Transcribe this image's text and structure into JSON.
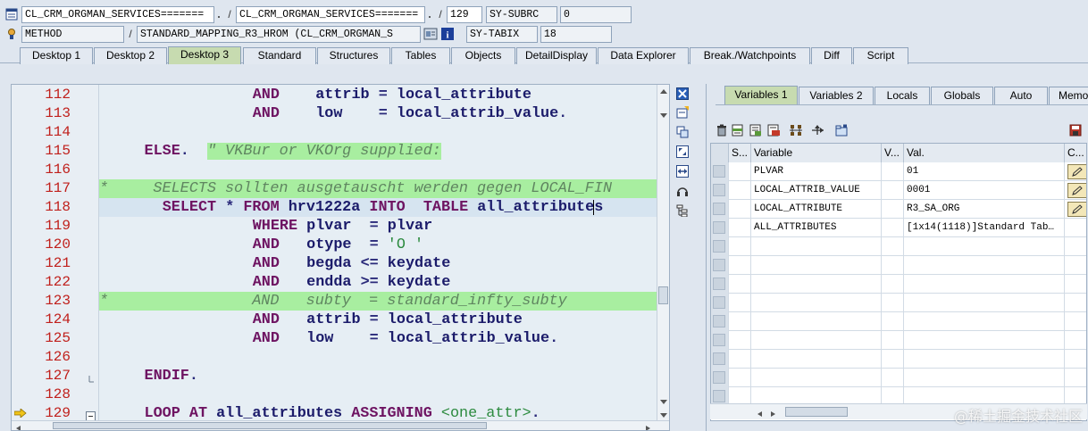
{
  "header": {
    "row1": {
      "program": "CL_CRM_ORGMAN_SERVICES=======",
      "include": "CL_CRM_ORGMAN_SERVICES=======",
      "line": "129",
      "sys_field": "SY-SUBRC",
      "sys_value": "0"
    },
    "row2": {
      "event_type": "METHOD",
      "event": "STANDARD_MAPPING_R3_HROM (CL_CRM_ORGMAN_S",
      "sys_field": "SY-TABIX",
      "sys_value": "18"
    }
  },
  "desktop_tabs": [
    "Desktop 1",
    "Desktop 2",
    "Desktop 3",
    "Standard",
    "Structures",
    "Tables",
    "Objects",
    "DetailDisplay",
    "Data Explorer",
    "Break./Watchpoints",
    "Diff",
    "Script"
  ],
  "active_desktop_tab": "Desktop 3",
  "code": {
    "current_line": "129",
    "lines": [
      {
        "no": "112",
        "text": "AND    attrib = local_attribute"
      },
      {
        "no": "113",
        "text": "AND    low    = local_attrib_value."
      },
      {
        "no": "114",
        "text": ""
      },
      {
        "no": "115",
        "text": "ELSE.  \" VKBur or VKOrg supplied:"
      },
      {
        "no": "116",
        "text": ""
      },
      {
        "no": "117",
        "text": "*     SELECTS sollten ausgetauscht werden gegen LOCAL_FIN"
      },
      {
        "no": "118",
        "text": "SELECT * FROM hrv1222a INTO  TABLE all_attributes"
      },
      {
        "no": "119",
        "text": "WHERE plvar  = plvar"
      },
      {
        "no": "120",
        "text": "AND   otype  = 'O '"
      },
      {
        "no": "121",
        "text": "AND   begda <= keydate"
      },
      {
        "no": "122",
        "text": "AND   endda >= keydate"
      },
      {
        "no": "123",
        "text": "*                AND   subty  = standard_infty_subty"
      },
      {
        "no": "124",
        "text": "AND   attrib = local_attribute"
      },
      {
        "no": "125",
        "text": "AND   low    = local_attrib_value."
      },
      {
        "no": "126",
        "text": ""
      },
      {
        "no": "127",
        "text": "ENDIF."
      },
      {
        "no": "128",
        "text": ""
      },
      {
        "no": "129",
        "text": "LOOP AT all_attributes ASSIGNING <one_attr>."
      }
    ]
  },
  "var_tabs": [
    "Variables 1",
    "Variables 2",
    "Locals",
    "Globals",
    "Auto",
    "Memory"
  ],
  "active_var_tab": "Variables 1",
  "var_grid": {
    "headers": {
      "s": "S...",
      "variable": "Variable",
      "v": "V...",
      "val": "Val.",
      "c": "C..."
    },
    "rows": [
      {
        "variable": "PLVAR",
        "value": "01",
        "changeable": true
      },
      {
        "variable": "LOCAL_ATTRIB_VALUE",
        "value": "0001",
        "changeable": true
      },
      {
        "variable": "LOCAL_ATTRIBUTE",
        "value": "R3_SA_ORG",
        "changeable": true
      },
      {
        "variable": "ALL_ATTRIBUTES",
        "value": "[1x14(1118)]Standard Tab…",
        "changeable": false
      }
    ]
  },
  "watermark": "@稀土掘金技术社区"
}
